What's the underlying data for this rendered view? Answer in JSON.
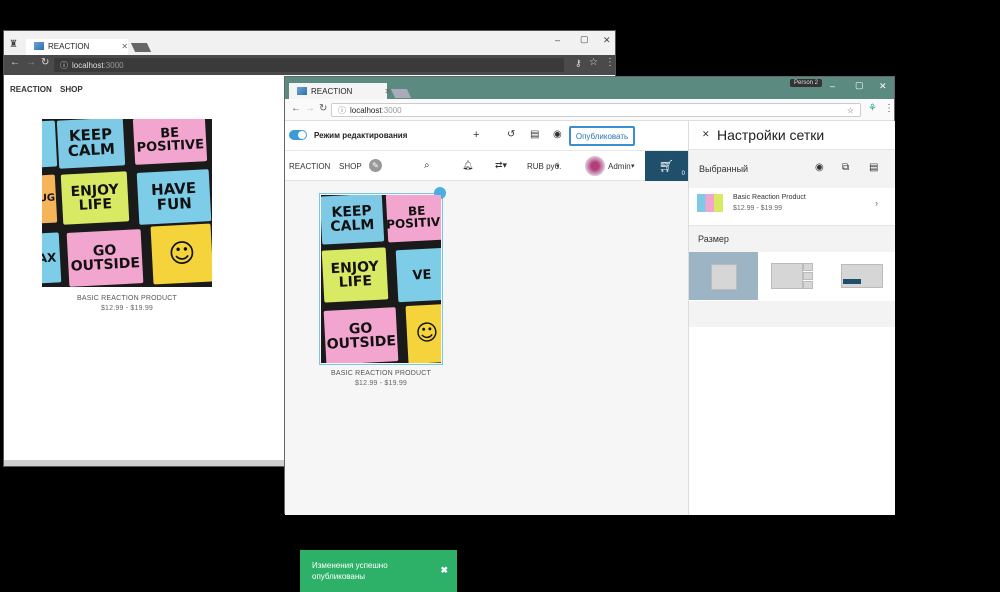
{
  "back_window": {
    "tab_title": "REACTION",
    "address": "localhost:3000",
    "address_host": "localhost",
    "address_port": ":3000",
    "nav": [
      "REACTION",
      "SHOP"
    ],
    "product": {
      "name": "BASIC REACTION PRODUCT",
      "price": "$12.99 - $19.99"
    }
  },
  "front_window": {
    "tab_title": "REACTION",
    "profile": "Person 2",
    "address_host": "localhost",
    "address_port": ":3000",
    "toolbar": {
      "edit_mode_label": "Режим редактирования",
      "publish_label": "Опубликовать"
    },
    "nav": {
      "brand": "REACTION",
      "shop": "SHOP",
      "currency": "RUB руб.",
      "user": "Admin",
      "cart_count": "0"
    },
    "product": {
      "name": "BASIC REACTION PRODUCT",
      "price": "$12.99 - $19.99"
    },
    "toast": {
      "message": "Изменения успешно опубликованы"
    },
    "side_panel": {
      "title": "Настройки сетки",
      "selected_label": "Выбранный",
      "selected_product": {
        "name": "Basic Reaction Product",
        "price": "$12.99 - $19.99"
      },
      "size_label": "Размер"
    }
  },
  "image_notes": {
    "keep_calm": "KEEP CALM",
    "be_positive": "BE POSITIVE",
    "enjoy_life": "ENJOY LIFE",
    "have_fun": "HAVE FUN",
    "go_outside": "GO OUTSIDE",
    "relax_fragment": "AX",
    "hug_fragment": "UG",
    "ve_fragment": "VE"
  },
  "colors": {
    "accent": "#3a9bd9",
    "cart": "#1f4f6b",
    "toast": "#2db168",
    "titlebar_front": "#5a8a80",
    "size_selected": "#9cb4c4"
  }
}
